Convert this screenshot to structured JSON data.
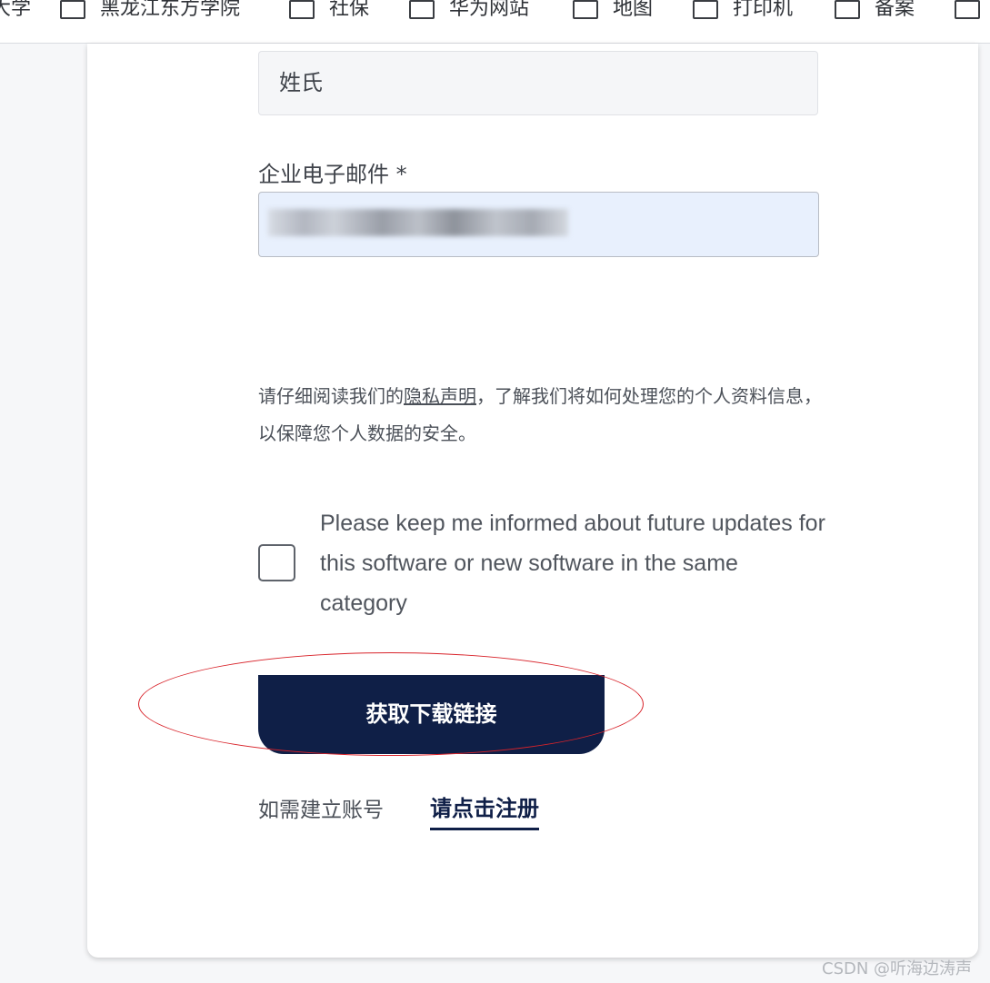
{
  "bookmarks": [
    {
      "label": "大学",
      "has_folder": false
    },
    {
      "label": "黑龙江东方学院",
      "has_folder": true
    },
    {
      "label": "社保",
      "has_folder": true
    },
    {
      "label": "华为网站",
      "has_folder": true
    },
    {
      "label": "地图",
      "has_folder": true
    },
    {
      "label": "打印机",
      "has_folder": true
    },
    {
      "label": "备案",
      "has_folder": true
    },
    {
      "label": "",
      "has_folder": true
    }
  ],
  "form": {
    "last_name_placeholder": "姓氏",
    "email_label": "企业电子邮件 *",
    "email_value_redacted": true,
    "privacy_prefix": "请仔细阅读我们的",
    "privacy_link": "隐私声明",
    "privacy_suffix": "，了解我们将如何处理您的个人资料信息，以保障您个人数据的安全。",
    "consent_checked": false,
    "consent_text": "Please keep me informed about future updates for this software or new software in the same category",
    "download_button": "获取下载链接",
    "register_prompt": "如需建立账号",
    "register_link": "请点击注册"
  },
  "annotation": {
    "ring_color": "#d8232a"
  },
  "colors": {
    "button_bg": "#0f1f47",
    "email_field_bg": "#e8f0fd"
  },
  "watermark": "CSDN @听海边涛声"
}
